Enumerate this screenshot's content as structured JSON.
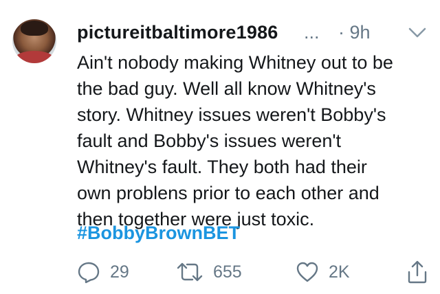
{
  "tweet": {
    "username": "pictureitbaltimore1986",
    "username_more": "...",
    "time": "· 9h",
    "text_lines": [
      "Ain't nobody making Whitney out to be",
      "the bad guy. Well all know Whitney's",
      "story. Whitney issues weren't Bobby's",
      "fault and Bobby's issues weren't",
      "Whitney's fault. They both had their",
      "own problens prior to each other and",
      "then together were just toxic."
    ],
    "hashtag": "#BobbyBrownBET",
    "actions": {
      "reply_icon": "reply-icon",
      "reply_count": "29",
      "retweet_icon": "retweet-icon",
      "retweet_count": "655",
      "like_icon": "heart-icon",
      "like_count": "2K",
      "share_icon": "share-icon"
    },
    "colors": {
      "text": "#14171a",
      "muted": "#657786",
      "link": "#1b95e0"
    }
  }
}
